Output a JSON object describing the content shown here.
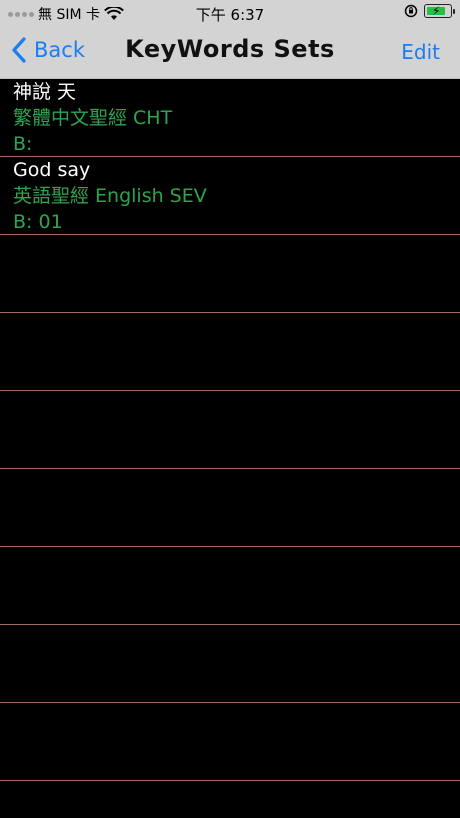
{
  "status": {
    "carrier": "無 SIM 卡",
    "time": "下午 6:37"
  },
  "nav": {
    "back_label": "Back",
    "title": "KeyWords Sets",
    "edit_label": "Edit"
  },
  "rows": [
    {
      "keywords": "神說 天",
      "bible": "繁體中文聖經 CHT",
      "book": "B:"
    },
    {
      "keywords": "God say",
      "bible": "英語聖經 English SEV",
      "book": "B: 01"
    }
  ],
  "colors": {
    "accent": "#1a7ef0",
    "green_text": "#2ea44f",
    "separator": "#a06a5c",
    "background": "#000000",
    "bar": "#d3d3d3"
  },
  "icons": [
    "signal-dots-icon",
    "wifi-icon",
    "orientation-lock-icon",
    "battery-charging-icon",
    "chevron-left-icon"
  ],
  "battery_level": 0.75
}
